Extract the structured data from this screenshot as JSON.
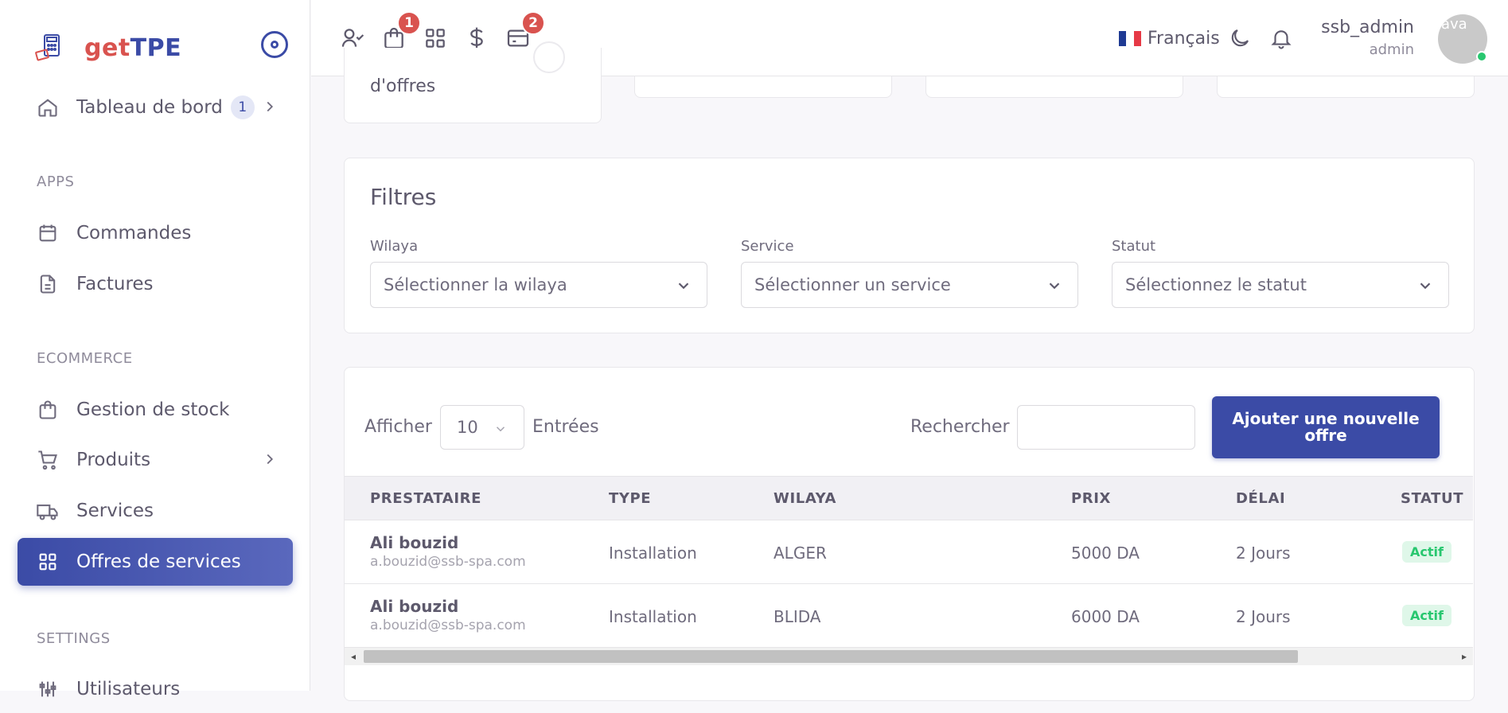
{
  "brand": {
    "name_part1": "get",
    "name_part2": "TPE"
  },
  "sidebar": {
    "dashboard": {
      "label": "Tableau de bord",
      "badge": "1"
    },
    "sections": {
      "apps": "APPS",
      "ecommerce": "ECOMMERCE",
      "settings": "SETTINGS"
    },
    "items": {
      "commandes": "Commandes",
      "factures": "Factures",
      "stock": "Gestion de stock",
      "produits": "Produits",
      "services": "Services",
      "offres": "Offres de services",
      "utilisateurs": "Utilisateurs"
    }
  },
  "topbar": {
    "badges": {
      "orders": "1",
      "cards": "2"
    },
    "language": "Français",
    "user": {
      "name": "ssb_admin",
      "role": "admin",
      "avatar_alt": "ava"
    }
  },
  "stat_card": {
    "text": "d'offres"
  },
  "filters": {
    "title": "Filtres",
    "wilaya": {
      "label": "Wilaya",
      "placeholder": "Sélectionner la wilaya"
    },
    "service": {
      "label": "Service",
      "placeholder": "Sélectionner un service"
    },
    "statut": {
      "label": "Statut",
      "placeholder": "Sélectionnez le statut"
    }
  },
  "table": {
    "show_label": "Afficher",
    "page_size": "10",
    "entries_label": "Entrées",
    "search_label": "Rechercher",
    "add_button": "Ajouter une nouvelle offre",
    "columns": {
      "prestataire": "PRESTATAIRE",
      "type": "TYPE",
      "wilaya": "WILAYA",
      "prix": "PRIX",
      "delai": "DÉLAI",
      "statut": "STATUT"
    },
    "rows": [
      {
        "name": "Ali bouzid",
        "email": "a.bouzid@ssb-spa.com",
        "type": "Installation",
        "wilaya": "ALGER",
        "prix": "5000 DA",
        "delai": "2 Jours",
        "statut": "Actif"
      },
      {
        "name": "Ali bouzid",
        "email": "a.bouzid@ssb-spa.com",
        "type": "Installation",
        "wilaya": "BLIDA",
        "prix": "6000 DA",
        "delai": "2 Jours",
        "statut": "Actif"
      }
    ]
  },
  "colors": {
    "primary": "#3b4ba6",
    "brand_red": "#d9534f",
    "success": "#28c76f"
  }
}
